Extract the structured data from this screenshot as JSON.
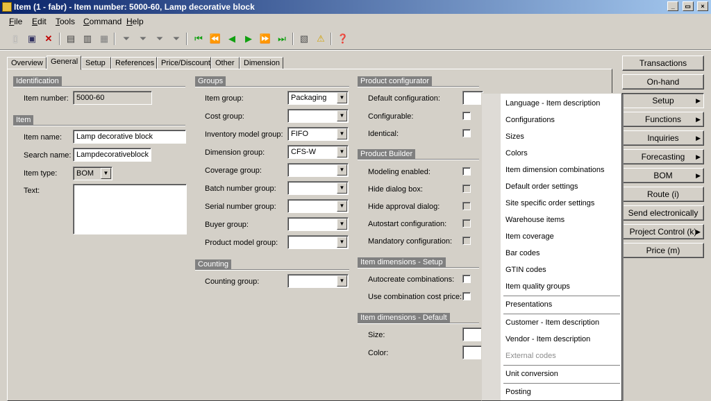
{
  "window": {
    "title": "Item (1 - fabr) - Item number: 5000-60, Lamp decorative block",
    "btn_min": "_",
    "btn_max": "▭",
    "btn_close": "×"
  },
  "menu": {
    "file_u": "F",
    "file_rest": "ile",
    "edit_u": "E",
    "edit_rest": "dit",
    "tools_u": "T",
    "tools_rest": "ools",
    "command_u": "C",
    "command_rest": "ommand",
    "help_u": "H",
    "help_rest": "elp"
  },
  "toolbar": {
    "icons": [
      "new-icon",
      "save-icon",
      "delete-icon",
      "print-icon",
      "print-preview-icon",
      "document-icon",
      "filter-icon",
      "filter-by-field-icon",
      "advanced-filter-icon",
      "remove-filter-icon",
      "first-record-icon",
      "previous-page-icon",
      "previous-record-icon",
      "next-record-icon",
      "next-page-icon",
      "last-record-icon",
      "clipboard-icon",
      "alert-icon",
      "help-icon"
    ]
  },
  "tabs": [
    "Overview",
    "General",
    "Setup",
    "References",
    "Price/Discount",
    "Other",
    "Dimension"
  ],
  "active_tab": "General",
  "identification": {
    "header": "Identification",
    "item_number_label": "Item number:",
    "item_number": "5000-60"
  },
  "item": {
    "header": "Item",
    "item_name_label": "Item name:",
    "item_name": "Lamp decorative block",
    "search_name_label": "Search name:",
    "search_name": "Lampdecorativeblock",
    "item_type_label": "Item type:",
    "item_type": "BOM",
    "text_label": "Text:"
  },
  "groups": {
    "header": "Groups",
    "item_group_label": "Item group:",
    "item_group": "Packaging",
    "cost_group_label": "Cost group:",
    "cost_group": "",
    "inventory_model_group_label": "Inventory model group:",
    "inventory_model_group": "FIFO",
    "dimension_group_label": "Dimension group:",
    "dimension_group": "CFS-W",
    "coverage_group_label": "Coverage group:",
    "coverage_group": "",
    "batch_number_group_label": "Batch number group:",
    "batch_number_group": "",
    "serial_number_group_label": "Serial number group:",
    "serial_number_group": "",
    "buyer_group_label": "Buyer group:",
    "buyer_group": "",
    "product_model_group_label": "Product model group:",
    "product_model_group": ""
  },
  "counting": {
    "header": "Counting",
    "counting_group_label": "Counting group:",
    "counting_group": ""
  },
  "product_configurator": {
    "header": "Product configurator",
    "default_configuration_label": "Default configuration:",
    "configurable_label": "Configurable:",
    "identical_label": "Identical:"
  },
  "product_builder": {
    "header": "Product Builder",
    "modeling_enabled_label": "Modeling enabled:",
    "hide_dialog_box_label": "Hide dialog box:",
    "hide_approval_dialog_label": "Hide approval dialog:",
    "autostart_configuration_label": "Autostart configuration:",
    "mandatory_configuration_label": "Mandatory configuration:"
  },
  "item_dimensions_setup": {
    "header": "Item dimensions - Setup",
    "autocreate_combinations_label": "Autocreate combinations:",
    "use_combination_cost_price_label": "Use combination cost price:"
  },
  "item_dimensions_default": {
    "header": "Item dimensions - Default",
    "size_label": "Size:",
    "color_label": "Color:"
  },
  "right_buttons": {
    "transactions": "Transactions",
    "on_hand": "On-hand",
    "setup": "Setup",
    "functions": "Functions",
    "inquiries": "Inquiries",
    "forecasting": "Forecasting",
    "bom": "BOM",
    "route": "Route (i)",
    "send_electronically": "Send electronically",
    "project_control": "Project Control (k)",
    "price": "Price (m)",
    "submenu_arrow": "▶"
  },
  "setup_menu": {
    "items": [
      "Language - Item description",
      "Configurations",
      "Sizes",
      "Colors",
      "Item dimension combinations",
      "Default order settings",
      "Site specific order settings",
      "Warehouse items",
      "Item coverage",
      "Bar codes",
      "GTIN codes",
      "Item quality groups",
      "Presentations",
      "Customer - Item description",
      "Vendor - Item description",
      "External codes",
      "Unit conversion",
      "Posting"
    ]
  }
}
